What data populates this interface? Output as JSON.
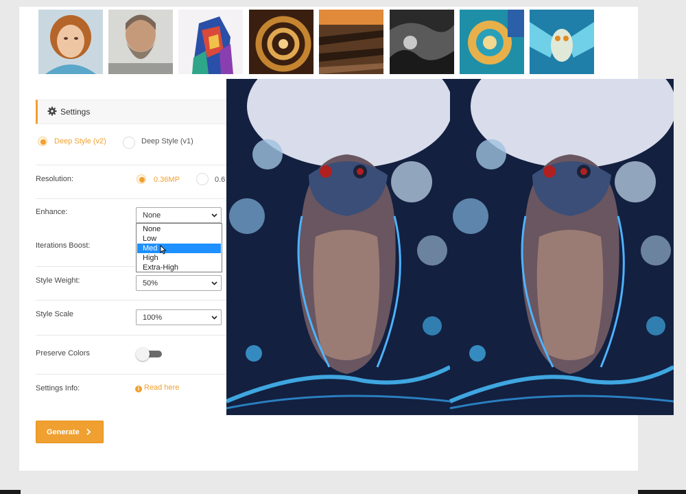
{
  "thumbnails": [
    {
      "name": "child-portrait"
    },
    {
      "name": "bearded-man-portrait"
    },
    {
      "name": "colorful-face-art"
    },
    {
      "name": "fractal-spiral"
    },
    {
      "name": "wooden-city"
    },
    {
      "name": "stormy-sea"
    },
    {
      "name": "spiral-mosaic"
    },
    {
      "name": "flying-owl-art"
    }
  ],
  "settings": {
    "header": "Settings",
    "icon": "gear-icon",
    "style_version": {
      "options": [
        {
          "label": "Deep Style (v2)",
          "selected": true
        },
        {
          "label": "Deep Style (v1)",
          "selected": false
        }
      ]
    },
    "resolution": {
      "label": "Resolution:",
      "options": [
        {
          "label": "0.36MP",
          "selected": true
        },
        {
          "label": "0.6",
          "selected": false
        }
      ]
    },
    "enhance": {
      "label": "Enhance:",
      "value": "None",
      "options": [
        "None",
        "Low",
        "Med",
        "High",
        "Extra-High"
      ],
      "highlighted": "Med"
    },
    "iterations_boost": {
      "label": "Iterations Boost:"
    },
    "style_weight": {
      "label": "Style Weight:",
      "value": "50%"
    },
    "style_scale": {
      "label": "Style Scale",
      "value": "100%"
    },
    "preserve_colors": {
      "label": "Preserve Colors",
      "enabled": false
    },
    "settings_info": {
      "label": "Settings Info:",
      "link": "Read here"
    },
    "generate_label": "Generate"
  },
  "colors": {
    "accent": "#f0a030",
    "selection": "#1e90ff"
  }
}
